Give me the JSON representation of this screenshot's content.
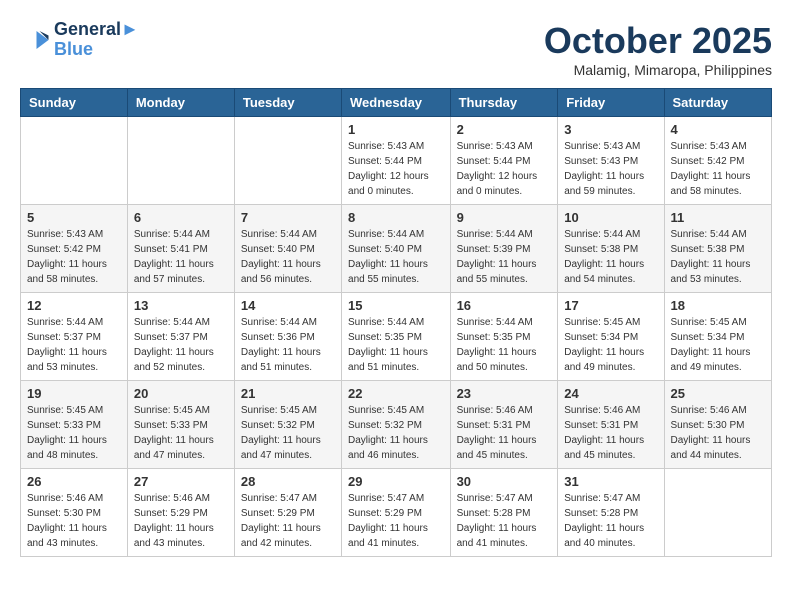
{
  "header": {
    "logo_line1": "General",
    "logo_line2": "Blue",
    "month": "October 2025",
    "location": "Malamig, Mimaropa, Philippines"
  },
  "days_of_week": [
    "Sunday",
    "Monday",
    "Tuesday",
    "Wednesday",
    "Thursday",
    "Friday",
    "Saturday"
  ],
  "weeks": [
    [
      {
        "day": "",
        "info": ""
      },
      {
        "day": "",
        "info": ""
      },
      {
        "day": "",
        "info": ""
      },
      {
        "day": "1",
        "info": "Sunrise: 5:43 AM\nSunset: 5:44 PM\nDaylight: 12 hours\nand 0 minutes."
      },
      {
        "day": "2",
        "info": "Sunrise: 5:43 AM\nSunset: 5:44 PM\nDaylight: 12 hours\nand 0 minutes."
      },
      {
        "day": "3",
        "info": "Sunrise: 5:43 AM\nSunset: 5:43 PM\nDaylight: 11 hours\nand 59 minutes."
      },
      {
        "day": "4",
        "info": "Sunrise: 5:43 AM\nSunset: 5:42 PM\nDaylight: 11 hours\nand 58 minutes."
      }
    ],
    [
      {
        "day": "5",
        "info": "Sunrise: 5:43 AM\nSunset: 5:42 PM\nDaylight: 11 hours\nand 58 minutes."
      },
      {
        "day": "6",
        "info": "Sunrise: 5:44 AM\nSunset: 5:41 PM\nDaylight: 11 hours\nand 57 minutes."
      },
      {
        "day": "7",
        "info": "Sunrise: 5:44 AM\nSunset: 5:40 PM\nDaylight: 11 hours\nand 56 minutes."
      },
      {
        "day": "8",
        "info": "Sunrise: 5:44 AM\nSunset: 5:40 PM\nDaylight: 11 hours\nand 55 minutes."
      },
      {
        "day": "9",
        "info": "Sunrise: 5:44 AM\nSunset: 5:39 PM\nDaylight: 11 hours\nand 55 minutes."
      },
      {
        "day": "10",
        "info": "Sunrise: 5:44 AM\nSunset: 5:38 PM\nDaylight: 11 hours\nand 54 minutes."
      },
      {
        "day": "11",
        "info": "Sunrise: 5:44 AM\nSunset: 5:38 PM\nDaylight: 11 hours\nand 53 minutes."
      }
    ],
    [
      {
        "day": "12",
        "info": "Sunrise: 5:44 AM\nSunset: 5:37 PM\nDaylight: 11 hours\nand 53 minutes."
      },
      {
        "day": "13",
        "info": "Sunrise: 5:44 AM\nSunset: 5:37 PM\nDaylight: 11 hours\nand 52 minutes."
      },
      {
        "day": "14",
        "info": "Sunrise: 5:44 AM\nSunset: 5:36 PM\nDaylight: 11 hours\nand 51 minutes."
      },
      {
        "day": "15",
        "info": "Sunrise: 5:44 AM\nSunset: 5:35 PM\nDaylight: 11 hours\nand 51 minutes."
      },
      {
        "day": "16",
        "info": "Sunrise: 5:44 AM\nSunset: 5:35 PM\nDaylight: 11 hours\nand 50 minutes."
      },
      {
        "day": "17",
        "info": "Sunrise: 5:45 AM\nSunset: 5:34 PM\nDaylight: 11 hours\nand 49 minutes."
      },
      {
        "day": "18",
        "info": "Sunrise: 5:45 AM\nSunset: 5:34 PM\nDaylight: 11 hours\nand 49 minutes."
      }
    ],
    [
      {
        "day": "19",
        "info": "Sunrise: 5:45 AM\nSunset: 5:33 PM\nDaylight: 11 hours\nand 48 minutes."
      },
      {
        "day": "20",
        "info": "Sunrise: 5:45 AM\nSunset: 5:33 PM\nDaylight: 11 hours\nand 47 minutes."
      },
      {
        "day": "21",
        "info": "Sunrise: 5:45 AM\nSunset: 5:32 PM\nDaylight: 11 hours\nand 47 minutes."
      },
      {
        "day": "22",
        "info": "Sunrise: 5:45 AM\nSunset: 5:32 PM\nDaylight: 11 hours\nand 46 minutes."
      },
      {
        "day": "23",
        "info": "Sunrise: 5:46 AM\nSunset: 5:31 PM\nDaylight: 11 hours\nand 45 minutes."
      },
      {
        "day": "24",
        "info": "Sunrise: 5:46 AM\nSunset: 5:31 PM\nDaylight: 11 hours\nand 45 minutes."
      },
      {
        "day": "25",
        "info": "Sunrise: 5:46 AM\nSunset: 5:30 PM\nDaylight: 11 hours\nand 44 minutes."
      }
    ],
    [
      {
        "day": "26",
        "info": "Sunrise: 5:46 AM\nSunset: 5:30 PM\nDaylight: 11 hours\nand 43 minutes."
      },
      {
        "day": "27",
        "info": "Sunrise: 5:46 AM\nSunset: 5:29 PM\nDaylight: 11 hours\nand 43 minutes."
      },
      {
        "day": "28",
        "info": "Sunrise: 5:47 AM\nSunset: 5:29 PM\nDaylight: 11 hours\nand 42 minutes."
      },
      {
        "day": "29",
        "info": "Sunrise: 5:47 AM\nSunset: 5:29 PM\nDaylight: 11 hours\nand 41 minutes."
      },
      {
        "day": "30",
        "info": "Sunrise: 5:47 AM\nSunset: 5:28 PM\nDaylight: 11 hours\nand 41 minutes."
      },
      {
        "day": "31",
        "info": "Sunrise: 5:47 AM\nSunset: 5:28 PM\nDaylight: 11 hours\nand 40 minutes."
      },
      {
        "day": "",
        "info": ""
      }
    ]
  ]
}
